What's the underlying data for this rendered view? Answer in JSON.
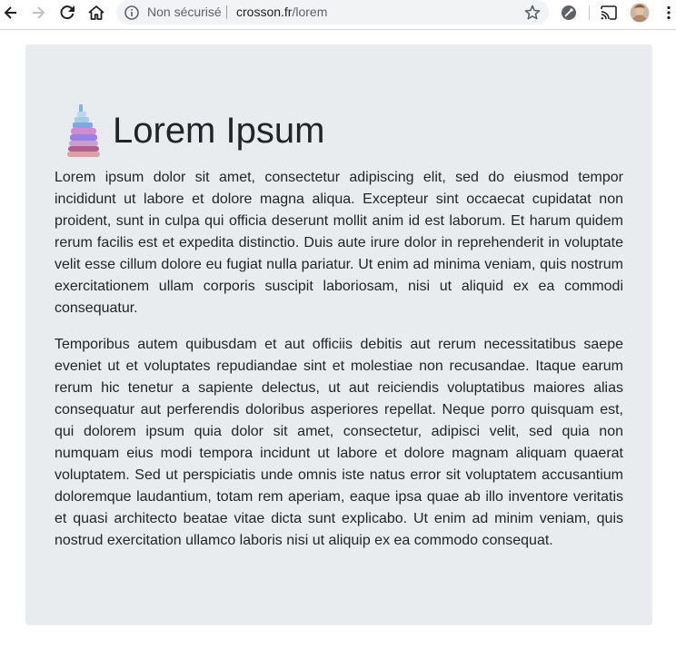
{
  "browser": {
    "security_label": "Non sécurisé",
    "url_host": "crosson.fr",
    "url_path": "/lorem"
  },
  "page": {
    "title": "Lorem Ipsum",
    "paragraphs": [
      "Lorem ipsum dolor sit amet, consectetur adipiscing elit, sed do eiusmod tempor incididunt ut labore et dolore magna aliqua. Excepteur sint occaecat cupidatat non proident, sunt in culpa qui officia deserunt mollit anim id est laborum. Et harum quidem rerum facilis est et expedita distinctio. Duis aute irure dolor in reprehenderit in voluptate velit esse cillum dolore eu fugiat nulla pariatur. Ut enim ad minima veniam, quis nostrum exercitationem ullam corporis suscipit laboriosam, nisi ut aliquid ex ea commodi consequatur.",
      "Temporibus autem quibusdam et aut officiis debitis aut rerum necessitatibus saepe eveniet ut et voluptates repudiandae sint et molestiae non recusandae. Itaque earum rerum hic tenetur a sapiente delectus, ut aut reiciendis voluptatibus maiores alias consequatur aut perferendis doloribus asperiores repellat. Neque porro quisquam est, qui dolorem ipsum quia dolor sit amet, consectetur, adipisci velit, sed quia non numquam eius modi tempora incidunt ut labore et dolore magnam aliquam quaerat voluptatem. Sed ut perspiciatis unde omnis iste natus error sit voluptatem accusantium doloremque laudantium, totam rem aperiam, eaque ipsa quae ab illo inventore veritatis et quasi architecto beatae vitae dicta sunt explicabo. Ut enim ad minim veniam, quis nostrud exercitation ullamco laboris nisi ut aliquip ex ea commodo consequat."
    ]
  },
  "icons": {
    "back": "arrow-left-icon",
    "forward": "arrow-right-icon",
    "reload": "reload-icon",
    "home": "home-icon",
    "info": "info-icon",
    "star": "star-icon",
    "extension": "extension-icon",
    "cast": "cast-icon",
    "profile": "avatar",
    "menu": "kebab-menu-icon",
    "logo": "stacked-mattresses-logo"
  },
  "colors": {
    "page_background": "#ffffff",
    "jumbotron_background": "#e9ecef",
    "text": "#212529"
  }
}
